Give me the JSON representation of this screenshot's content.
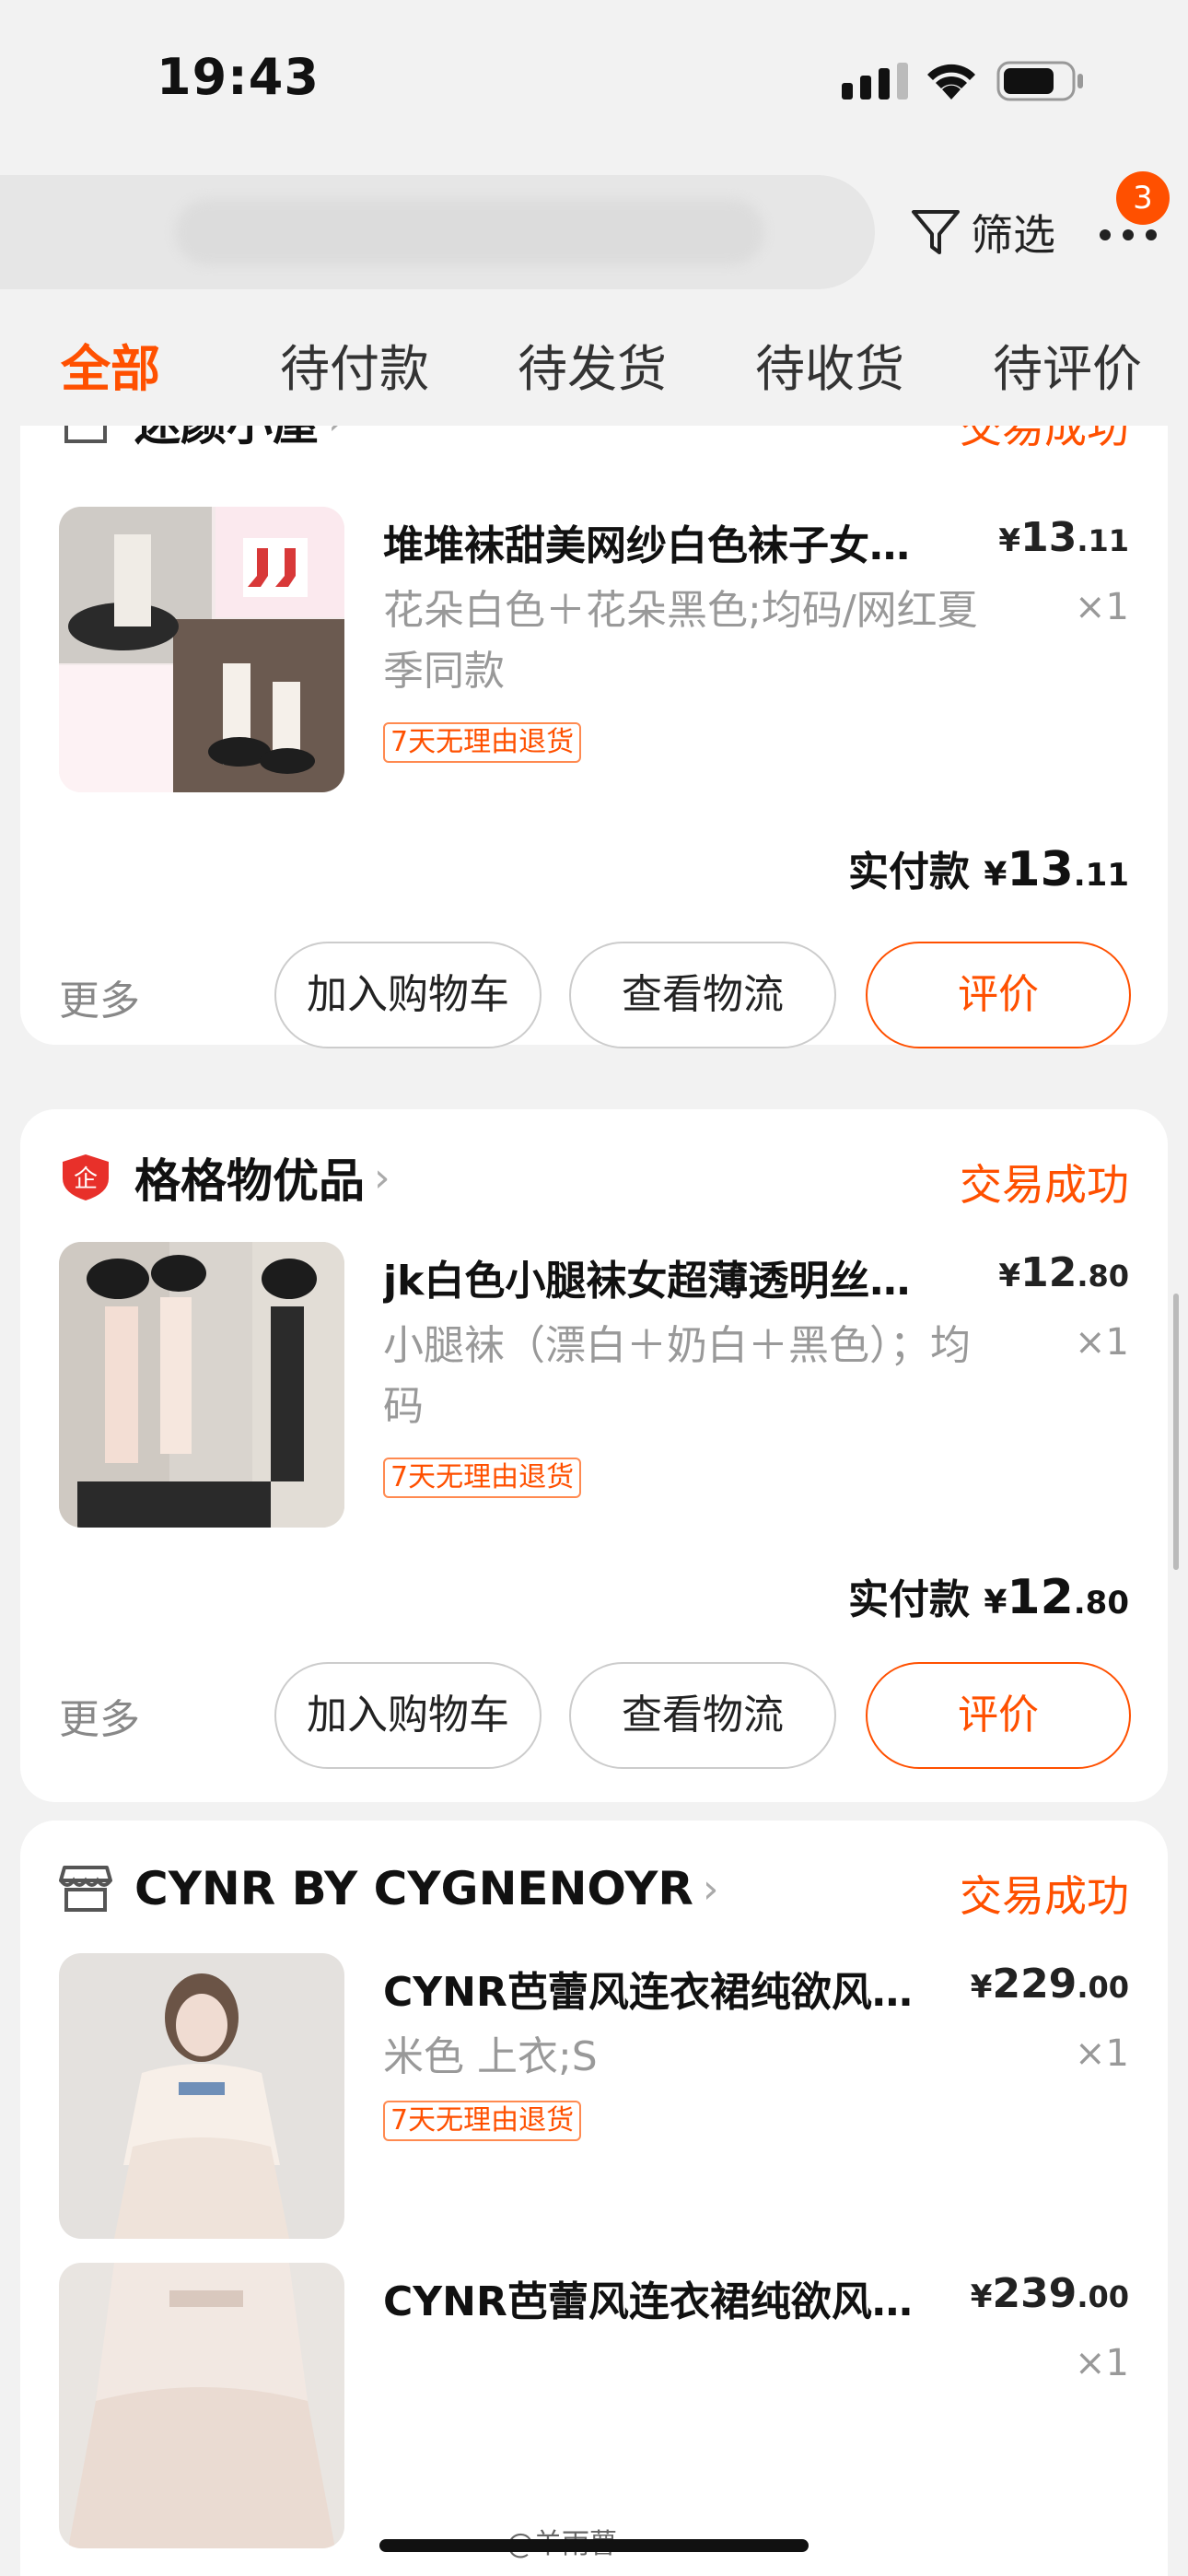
{
  "status_bar": {
    "time": "19:43"
  },
  "header": {
    "filter_label": "筛选",
    "more_badge": "3"
  },
  "tabs": [
    {
      "label": "全部",
      "active": true
    },
    {
      "label": "待付款"
    },
    {
      "label": "待发货"
    },
    {
      "label": "待收货"
    },
    {
      "label": "待评价"
    }
  ],
  "orders": [
    {
      "shop": "迷颜小屋",
      "status": "交易成功",
      "items": [
        {
          "title": "堆堆袜甜美网纱白色袜子女…",
          "price_int": "13",
          "price_dec": ".11",
          "sku": "花朵白色＋花朵黑色;均码/网红夏季同款",
          "qty": "×1",
          "tag": "7天无理由退货"
        }
      ],
      "paid_label": "实付款",
      "paid_int": "13",
      "paid_dec": ".11",
      "more": "更多",
      "buttons": {
        "cart": "加入购物车",
        "logistics": "查看物流",
        "review": "评价"
      }
    },
    {
      "shop": "格格物优品",
      "status": "交易成功",
      "items": [
        {
          "title": "jk白色小腿袜女超薄透明丝…",
          "price_int": "12",
          "price_dec": ".80",
          "sku": "小腿袜（漂白＋奶白＋黑色）；均码",
          "qty": "×1",
          "tag": "7天无理由退货"
        }
      ],
      "paid_label": "实付款",
      "paid_int": "12",
      "paid_dec": ".80",
      "more": "更多",
      "buttons": {
        "cart": "加入购物车",
        "logistics": "查看物流",
        "review": "评价"
      }
    },
    {
      "shop": "CYNR BY CYGNENOYR",
      "status": "交易成功",
      "items": [
        {
          "title": "CYNR芭蕾风连衣裙纯欲风…",
          "price_int": "229",
          "price_dec": ".00",
          "sku": "米色 上衣;S",
          "qty": "×1",
          "tag": "7天无理由退货"
        },
        {
          "title": "CYNR芭蕾风连衣裙纯欲风…",
          "price_int": "239",
          "price_dec": ".00",
          "sku": "",
          "qty": "×1"
        }
      ]
    }
  ],
  "currency": "¥",
  "watermark": "@羊雨瞢",
  "colors": {
    "accent": "#ff5000",
    "background": "#f2f2f2"
  }
}
